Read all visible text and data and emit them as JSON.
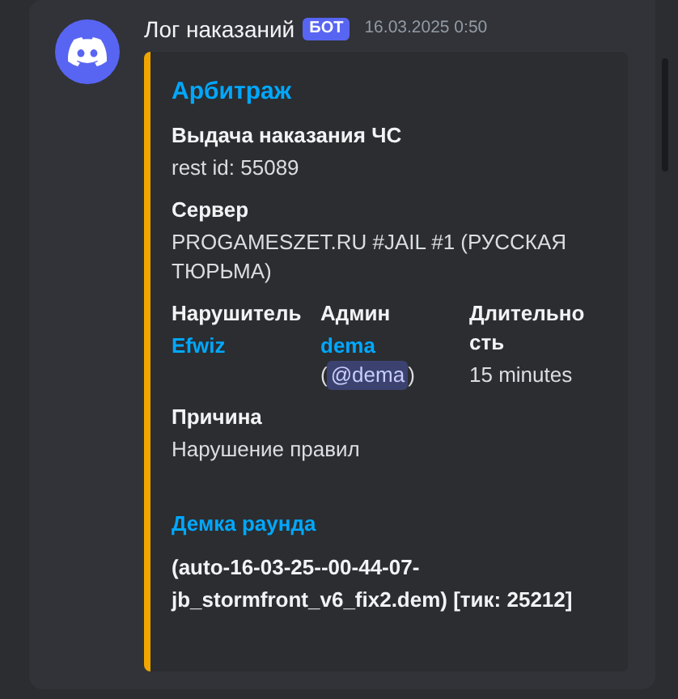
{
  "message": {
    "author": "Лог наказаний",
    "badge": "БОТ",
    "timestamp": "16.03.2025 0:50"
  },
  "embed": {
    "title": "Арбитраж",
    "fields": [
      {
        "name": "Выдача наказания ЧС",
        "value": "rest id: 55089",
        "kind": "text",
        "inline": false
      },
      {
        "name": "Сервер",
        "value": "PROGAMESZET.RU #JAIL #1 (РУССКАЯ ТЮРЬМА)",
        "kind": "text",
        "inline": false
      },
      {
        "name": "Нарушитель",
        "value": "Efwiz",
        "kind": "link",
        "inline": true
      },
      {
        "name": "Админ",
        "value": "dema",
        "mention_open": "(",
        "mention": "@dema",
        "mention_close": ")",
        "kind": "user",
        "inline": true
      },
      {
        "name": "Длительность",
        "value": "15 minutes",
        "kind": "text",
        "inline": true
      },
      {
        "name": "Причина",
        "value": "Нарушение правил",
        "kind": "text",
        "inline": false
      }
    ],
    "footer_title": "Демка раунда",
    "footer_text": "(auto-16-03-25--00-44-07-jb_stormfront_v6_fix2.dem) [тик: 25212]"
  }
}
